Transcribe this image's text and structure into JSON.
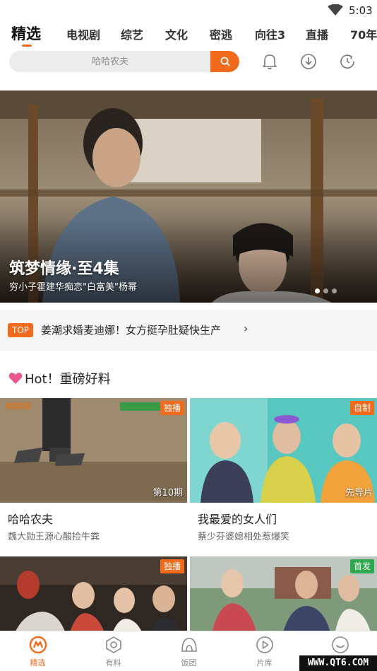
{
  "status": {
    "time": "5:03"
  },
  "tabs": [
    {
      "label": "精选",
      "active": true
    },
    {
      "label": "电视剧"
    },
    {
      "label": "综艺"
    },
    {
      "label": "文化"
    },
    {
      "label": "密逃"
    },
    {
      "label": "向往3"
    },
    {
      "label": "直播"
    },
    {
      "label": "70年"
    }
  ],
  "search": {
    "placeholder": "哈哈农夫"
  },
  "header_icons": [
    "bell-icon",
    "download-icon",
    "history-icon"
  ],
  "banner": {
    "title": "筑梦情缘·至4集",
    "subtitle": "穷小子霍建华痴恋\"白富美\"杨幂",
    "dot_count": 3,
    "active_dot": 0
  },
  "news": {
    "badge": "TOP",
    "text": "姜潮求婚麦迪娜！女方挺孕肚疑快生产",
    "arrow": "›"
  },
  "section": {
    "title": "Hot！重磅好料"
  },
  "cards": [
    {
      "title": "哈哈农夫",
      "subtitle": "魏大勋王源心酸捡牛粪",
      "badge": "独播",
      "badge_color": "#f26b1d",
      "episode": "第10期"
    },
    {
      "title": "我最爱的女人们",
      "subtitle": "蔡少芬婆媳相处惹爆笑",
      "badge": "自制",
      "badge_color": "#f26b1d",
      "episode": "先导片"
    },
    {
      "title": "",
      "subtitle": "",
      "badge": "独播",
      "badge_color": "#f26b1d",
      "episode": ""
    },
    {
      "title": "",
      "subtitle": "",
      "badge": "首发",
      "badge_color": "#2fa84f",
      "episode": ""
    }
  ],
  "bottom_nav": [
    {
      "label": "精选",
      "icon": "featured-icon",
      "active": true
    },
    {
      "label": "有料",
      "icon": "discover-icon"
    },
    {
      "label": "饭团",
      "icon": "fan-group-icon"
    },
    {
      "label": "片库",
      "icon": "library-play-icon"
    },
    {
      "label": "",
      "icon": "profile-smile-icon"
    }
  ],
  "watermark": "WWW.QT6.COM",
  "colors": {
    "accent": "#f26b1d",
    "green_badge": "#2fa84f"
  }
}
